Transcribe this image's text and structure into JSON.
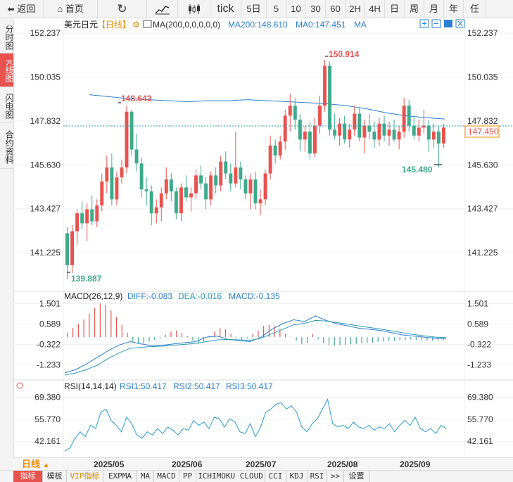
{
  "toolbar": {
    "back": "返回",
    "home": "首页",
    "periods": [
      "tick",
      "5日",
      "5",
      "10",
      "30",
      "60",
      "2H",
      "4H",
      "日",
      "周",
      "月",
      "年",
      "任"
    ]
  },
  "sidebar": [
    "分时图",
    "K线图",
    "闪电图",
    "合约资料"
  ],
  "main_legend": {
    "symbol": "美元日元",
    "period": "【日线】",
    "ma_label": "MA(200,0,0,0,0,0)",
    "ma200": "MA200:148.610",
    "ma0": "MA0:147.451",
    "ma": "MA"
  },
  "price_axis": [
    "152.237",
    "150.035",
    "147.832",
    "145.630",
    "143.427",
    "141.225"
  ],
  "current_price": "147.450",
  "annotations": {
    "high": "150.914",
    "may_high": "148.643",
    "low": "139.887",
    "recent_low": "145.480"
  },
  "macd_legend": {
    "title": "MACD(26,12,9)",
    "diff": "DIFF:-0.083",
    "dea": "DEA:-0.016",
    "macd": "MACD:-0.135"
  },
  "macd_axis": [
    "1.501",
    "0.589",
    "-0.322",
    "-1.233"
  ],
  "rsi_legend": {
    "title": "RSI(14,14,14)",
    "rsi1": "RSI1:50.417",
    "rsi2": "RSI2:50.417",
    "rsi3": "RSI3:50.417"
  },
  "rsi_axis": [
    "69.380",
    "55.770",
    "42.161"
  ],
  "date_axis": [
    "2025/05",
    "2025/06",
    "2025/07",
    "2025/08",
    "2025/09"
  ],
  "period_label": "日线",
  "bottom_tabs": [
    "指标",
    "模板",
    "VIP指标",
    "EXPMA",
    "MA",
    "MACD",
    "PP",
    "ICHIMOKU CLOUD",
    "CCI",
    "KDJ",
    "RSI",
    ">>",
    "设置"
  ],
  "colors": {
    "up": "#e8534f",
    "down": "#3daa8b",
    "ma200": "#2d7fd1",
    "current": "#2a9bb8"
  },
  "chart_data": {
    "type": "candlestick",
    "title": "美元日元 日线",
    "ylim": [
      139.5,
      152.7
    ],
    "ohlc": [
      [
        142.2,
        142.5,
        139.9,
        140.6
      ],
      [
        140.6,
        142.6,
        140.2,
        142.3
      ],
      [
        142.3,
        143.4,
        141.6,
        143.2
      ],
      [
        143.2,
        143.8,
        142.4,
        142.7
      ],
      [
        142.7,
        143.7,
        141.8,
        143.4
      ],
      [
        143.4,
        144.1,
        142.6,
        142.8
      ],
      [
        142.8,
        143.9,
        142.5,
        143.6
      ],
      [
        143.6,
        145.2,
        143.3,
        144.8
      ],
      [
        144.8,
        146.1,
        144.2,
        145.5
      ],
      [
        145.5,
        146.2,
        143.6,
        143.9
      ],
      [
        143.9,
        145.3,
        143.6,
        145.0
      ],
      [
        145.0,
        145.9,
        144.7,
        145.5
      ],
      [
        145.5,
        148.6,
        145.2,
        148.3
      ],
      [
        148.3,
        148.4,
        146.1,
        146.4
      ],
      [
        146.4,
        147.2,
        145.3,
        145.7
      ],
      [
        145.7,
        146.0,
        144.0,
        144.4
      ],
      [
        144.4,
        145.0,
        143.6,
        144.3
      ],
      [
        144.3,
        144.6,
        142.6,
        143.2
      ],
      [
        143.2,
        143.9,
        142.7,
        143.5
      ],
      [
        143.5,
        144.5,
        142.8,
        144.2
      ],
      [
        144.2,
        145.5,
        143.9,
        144.9
      ],
      [
        144.9,
        145.2,
        143.8,
        144.3
      ],
      [
        144.3,
        144.5,
        142.9,
        143.2
      ],
      [
        143.2,
        144.7,
        142.8,
        144.5
      ],
      [
        144.5,
        145.1,
        143.8,
        144.0
      ],
      [
        144.0,
        144.5,
        143.3,
        144.2
      ],
      [
        144.2,
        145.4,
        143.9,
        145.1
      ],
      [
        145.1,
        145.6,
        144.4,
        144.7
      ],
      [
        144.7,
        145.0,
        143.4,
        143.9
      ],
      [
        143.9,
        145.3,
        143.6,
        145.1
      ],
      [
        145.1,
        145.5,
        144.2,
        144.6
      ],
      [
        144.6,
        146.1,
        144.3,
        145.8
      ],
      [
        145.8,
        146.3,
        144.9,
        145.2
      ],
      [
        145.2,
        145.7,
        144.3,
        144.7
      ],
      [
        144.7,
        147.3,
        144.5,
        145.5
      ],
      [
        145.5,
        145.8,
        144.4,
        144.9
      ],
      [
        144.9,
        145.1,
        143.9,
        144.2
      ],
      [
        144.2,
        145.2,
        143.4,
        144.9
      ],
      [
        144.9,
        145.3,
        143.4,
        143.7
      ],
      [
        143.7,
        144.4,
        143.1,
        143.9
      ],
      [
        143.9,
        145.4,
        143.6,
        145.2
      ],
      [
        145.2,
        147.1,
        144.9,
        146.6
      ],
      [
        146.6,
        146.9,
        145.7,
        146.1
      ],
      [
        146.1,
        147.1,
        145.9,
        146.8
      ],
      [
        146.8,
        148.4,
        146.4,
        148.1
      ],
      [
        148.1,
        149.2,
        147.3,
        148.6
      ],
      [
        148.6,
        149.0,
        147.4,
        147.9
      ],
      [
        147.9,
        148.2,
        146.3,
        146.9
      ],
      [
        146.9,
        147.6,
        146.3,
        147.3
      ],
      [
        147.3,
        147.8,
        145.9,
        146.2
      ],
      [
        146.2,
        148.0,
        146.0,
        147.6
      ],
      [
        147.6,
        149.1,
        147.2,
        148.6
      ],
      [
        148.6,
        150.9,
        148.3,
        150.6
      ],
      [
        150.6,
        150.8,
        147.1,
        147.4
      ],
      [
        147.4,
        148.2,
        146.9,
        147.1
      ],
      [
        147.1,
        148.0,
        146.6,
        147.7
      ],
      [
        147.7,
        148.1,
        146.7,
        146.9
      ],
      [
        146.9,
        147.7,
        146.5,
        147.4
      ],
      [
        147.4,
        148.6,
        147.1,
        148.2
      ],
      [
        148.2,
        148.5,
        146.8,
        147.0
      ],
      [
        147.0,
        147.9,
        146.2,
        147.6
      ],
      [
        147.6,
        148.2,
        146.9,
        147.3
      ],
      [
        147.3,
        147.8,
        146.5,
        146.9
      ],
      [
        146.9,
        148.0,
        146.6,
        147.7
      ],
      [
        147.7,
        148.1,
        146.8,
        147.1
      ],
      [
        147.1,
        147.8,
        146.6,
        147.4
      ],
      [
        147.4,
        147.9,
        146.8,
        146.9
      ],
      [
        146.9,
        147.6,
        146.4,
        147.3
      ],
      [
        147.3,
        149.0,
        147.0,
        148.6
      ],
      [
        148.6,
        148.9,
        147.3,
        147.6
      ],
      [
        147.6,
        148.0,
        146.9,
        147.1
      ],
      [
        147.1,
        147.9,
        146.8,
        147.5
      ],
      [
        147.5,
        148.4,
        147.2,
        147.6
      ],
      [
        147.6,
        147.9,
        146.3,
        146.9
      ],
      [
        146.9,
        147.7,
        146.5,
        147.3
      ],
      [
        147.3,
        147.6,
        145.5,
        146.7
      ],
      [
        146.7,
        147.7,
        146.5,
        147.5
      ]
    ],
    "ma200": [
      149.15,
      149.05,
      148.95,
      148.9,
      148.85,
      148.8,
      148.85,
      148.85,
      148.9,
      148.85,
      148.8,
      148.75,
      148.7,
      148.6,
      148.45,
      148.25,
      148.1,
      148.0,
      147.93
    ],
    "macd": {
      "ylim": [
        -1.6,
        1.8
      ],
      "diff": [
        -1.6,
        -1.45,
        -1.2,
        -0.9,
        -0.6,
        -0.35,
        -0.2,
        -0.3,
        -0.38,
        -0.36,
        -0.3,
        -0.25,
        -0.2,
        0.0,
        0.05,
        -0.1,
        -0.15,
        -0.2,
        0.0,
        0.35,
        0.6,
        0.78,
        0.7,
        0.95,
        0.75,
        0.6,
        0.5,
        0.4,
        0.35,
        0.3,
        0.2,
        0.1,
        0.05,
        0.0,
        -0.05,
        -0.08
      ],
      "dea": [
        -1.7,
        -1.6,
        -1.45,
        -1.25,
        -0.95,
        -0.7,
        -0.5,
        -0.45,
        -0.42,
        -0.4,
        -0.36,
        -0.32,
        -0.28,
        -0.2,
        -0.12,
        -0.1,
        -0.12,
        -0.14,
        -0.05,
        0.15,
        0.35,
        0.55,
        0.62,
        0.75,
        0.72,
        0.65,
        0.58,
        0.5,
        0.43,
        0.36,
        0.28,
        0.2,
        0.12,
        0.06,
        0.0,
        -0.02
      ],
      "hist": [
        0.2,
        0.4,
        0.6,
        0.8,
        1.05,
        1.3,
        1.5,
        1.45,
        1.2,
        0.9,
        0.55,
        0.2,
        -0.2,
        -0.3,
        -0.28,
        -0.2,
        -0.12,
        -0.05,
        0.1,
        0.25,
        0.3,
        0.2,
        0.05,
        -0.15,
        -0.3,
        -0.2,
        0.05,
        0.25,
        0.4,
        0.35,
        0.15,
        -0.05,
        -0.1,
        -0.05,
        0.15,
        0.3,
        0.5,
        0.55,
        0.5,
        0.35,
        0.15,
        0.02,
        -0.15,
        -0.32,
        -0.28,
        0.15,
        -0.1,
        -0.28,
        -0.35,
        -0.38,
        -0.36,
        -0.34,
        -0.32,
        -0.3,
        -0.28,
        -0.26,
        -0.24,
        -0.22,
        -0.2,
        -0.18,
        -0.16,
        -0.14,
        -0.12,
        -0.1,
        -0.12,
        -0.14,
        -0.16,
        -0.15,
        -0.14,
        -0.135
      ]
    },
    "rsi": {
      "ylim": [
        34,
        73
      ],
      "values": [
        36,
        38,
        44,
        48,
        45,
        52,
        50,
        60,
        62,
        55,
        52,
        48,
        57,
        53,
        46,
        44,
        48,
        46,
        50,
        47,
        51,
        49,
        46,
        50,
        49,
        55,
        52,
        54,
        50,
        57,
        56,
        51,
        56,
        54,
        48,
        47,
        53,
        45,
        51,
        60,
        62,
        65,
        66,
        62,
        64,
        60,
        51,
        48,
        53,
        56,
        62,
        68,
        53,
        51,
        52,
        50,
        54,
        51,
        50,
        52,
        49,
        51,
        50,
        53,
        48,
        52,
        55,
        52,
        57,
        50,
        48,
        50,
        47,
        52,
        50
      ]
    }
  }
}
